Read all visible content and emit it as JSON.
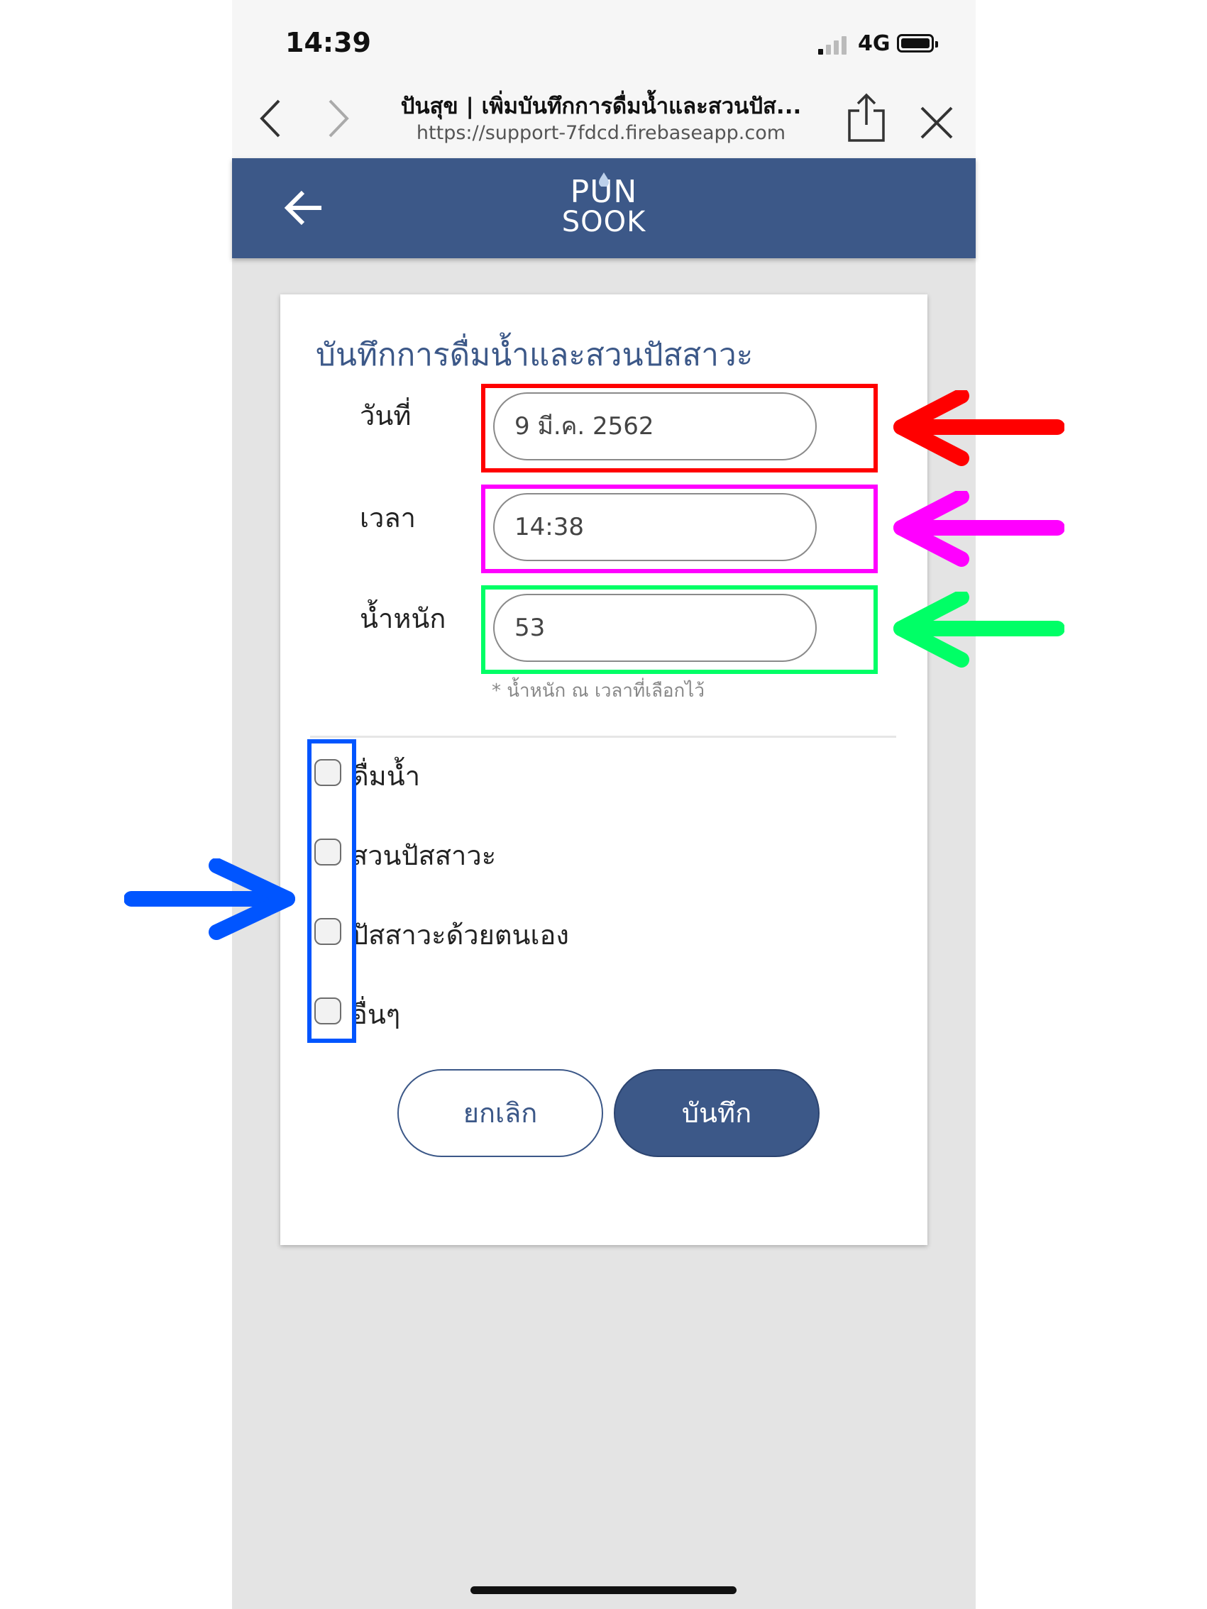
{
  "status_bar": {
    "time": "14:39",
    "network": "4G"
  },
  "browser": {
    "page_title": "ปันสุข | เพิ่มบันทึกการดื่มน้ำและสวนปัส...",
    "url": "https://support-7fdcd.firebaseapp.com"
  },
  "app": {
    "logo_line1": "PUN",
    "logo_line2": "SOOK"
  },
  "form": {
    "title": "บันทึกการดื่มน้ำและสวนปัสสาวะ",
    "date_label": "วันที่",
    "date_value": "9 มี.ค. 2562",
    "time_label": "เวลา",
    "time_value": "14:38",
    "weight_label": "น้ำหนัก",
    "weight_value": "53",
    "weight_hint": "* น้ำหนัก ณ เวลาที่เลือกไว้",
    "options": [
      "ดื่มน้ำ",
      "สวนปัสสาวะ",
      "ปัสสาวะด้วยตนเอง",
      "อื่นๆ"
    ],
    "cancel_label": "ยกเลิก",
    "save_label": "บันทึก"
  },
  "annotation_colors": {
    "date": "#ff0000",
    "time": "#ff00ff",
    "weight": "#00ff66",
    "checkboxes": "#0055ff"
  }
}
